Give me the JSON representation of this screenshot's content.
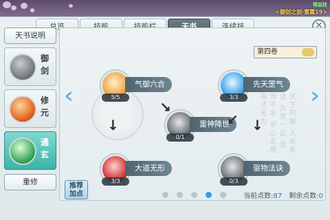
{
  "corner": {
    "line1": "得益技",
    "line2": "<御剑之剑·雷霆19>"
  },
  "tabs": [
    "总览",
    "技能",
    "技能栏",
    "天书",
    "连续技"
  ],
  "active_tab": "天书",
  "sidebar": {
    "info_button": "天书说明",
    "schools": [
      {
        "name": "御剑",
        "orb_color": "#8a8f94",
        "active": false
      },
      {
        "name": "修元",
        "orb_color": "#e0641f",
        "active": false
      },
      {
        "name": "通玄",
        "orb_color": "#3aa65a",
        "active": true
      }
    ],
    "reset_button": "重修"
  },
  "volume_select": {
    "value": "第四卷"
  },
  "skills": [
    {
      "name": "气御六合",
      "level": "5/5",
      "color": "#f0a44a"
    },
    {
      "name": "先天罡气",
      "level": "3/3",
      "color": "#3ea4e8"
    },
    {
      "name": "雷神降世",
      "level": "0/1",
      "color": "#6d7176"
    },
    {
      "name": "大道无形",
      "level": "3/3",
      "color": "#d23b3b"
    },
    {
      "name": "驱物法诀",
      "level": "0/3",
      "color": "#70757a"
    }
  ],
  "recommend_button": {
    "line1": "推荐",
    "line2": "加点"
  },
  "pager": {
    "count": 5,
    "active": 3
  },
  "points": {
    "current_label": "当前点数:",
    "current_value": "87",
    "remain_label": "剩余点数:",
    "remain_value": "0"
  },
  "calligraphy": "天下何御 人长者法 为我一云 道世不名 学心玄用 自达无为"
}
